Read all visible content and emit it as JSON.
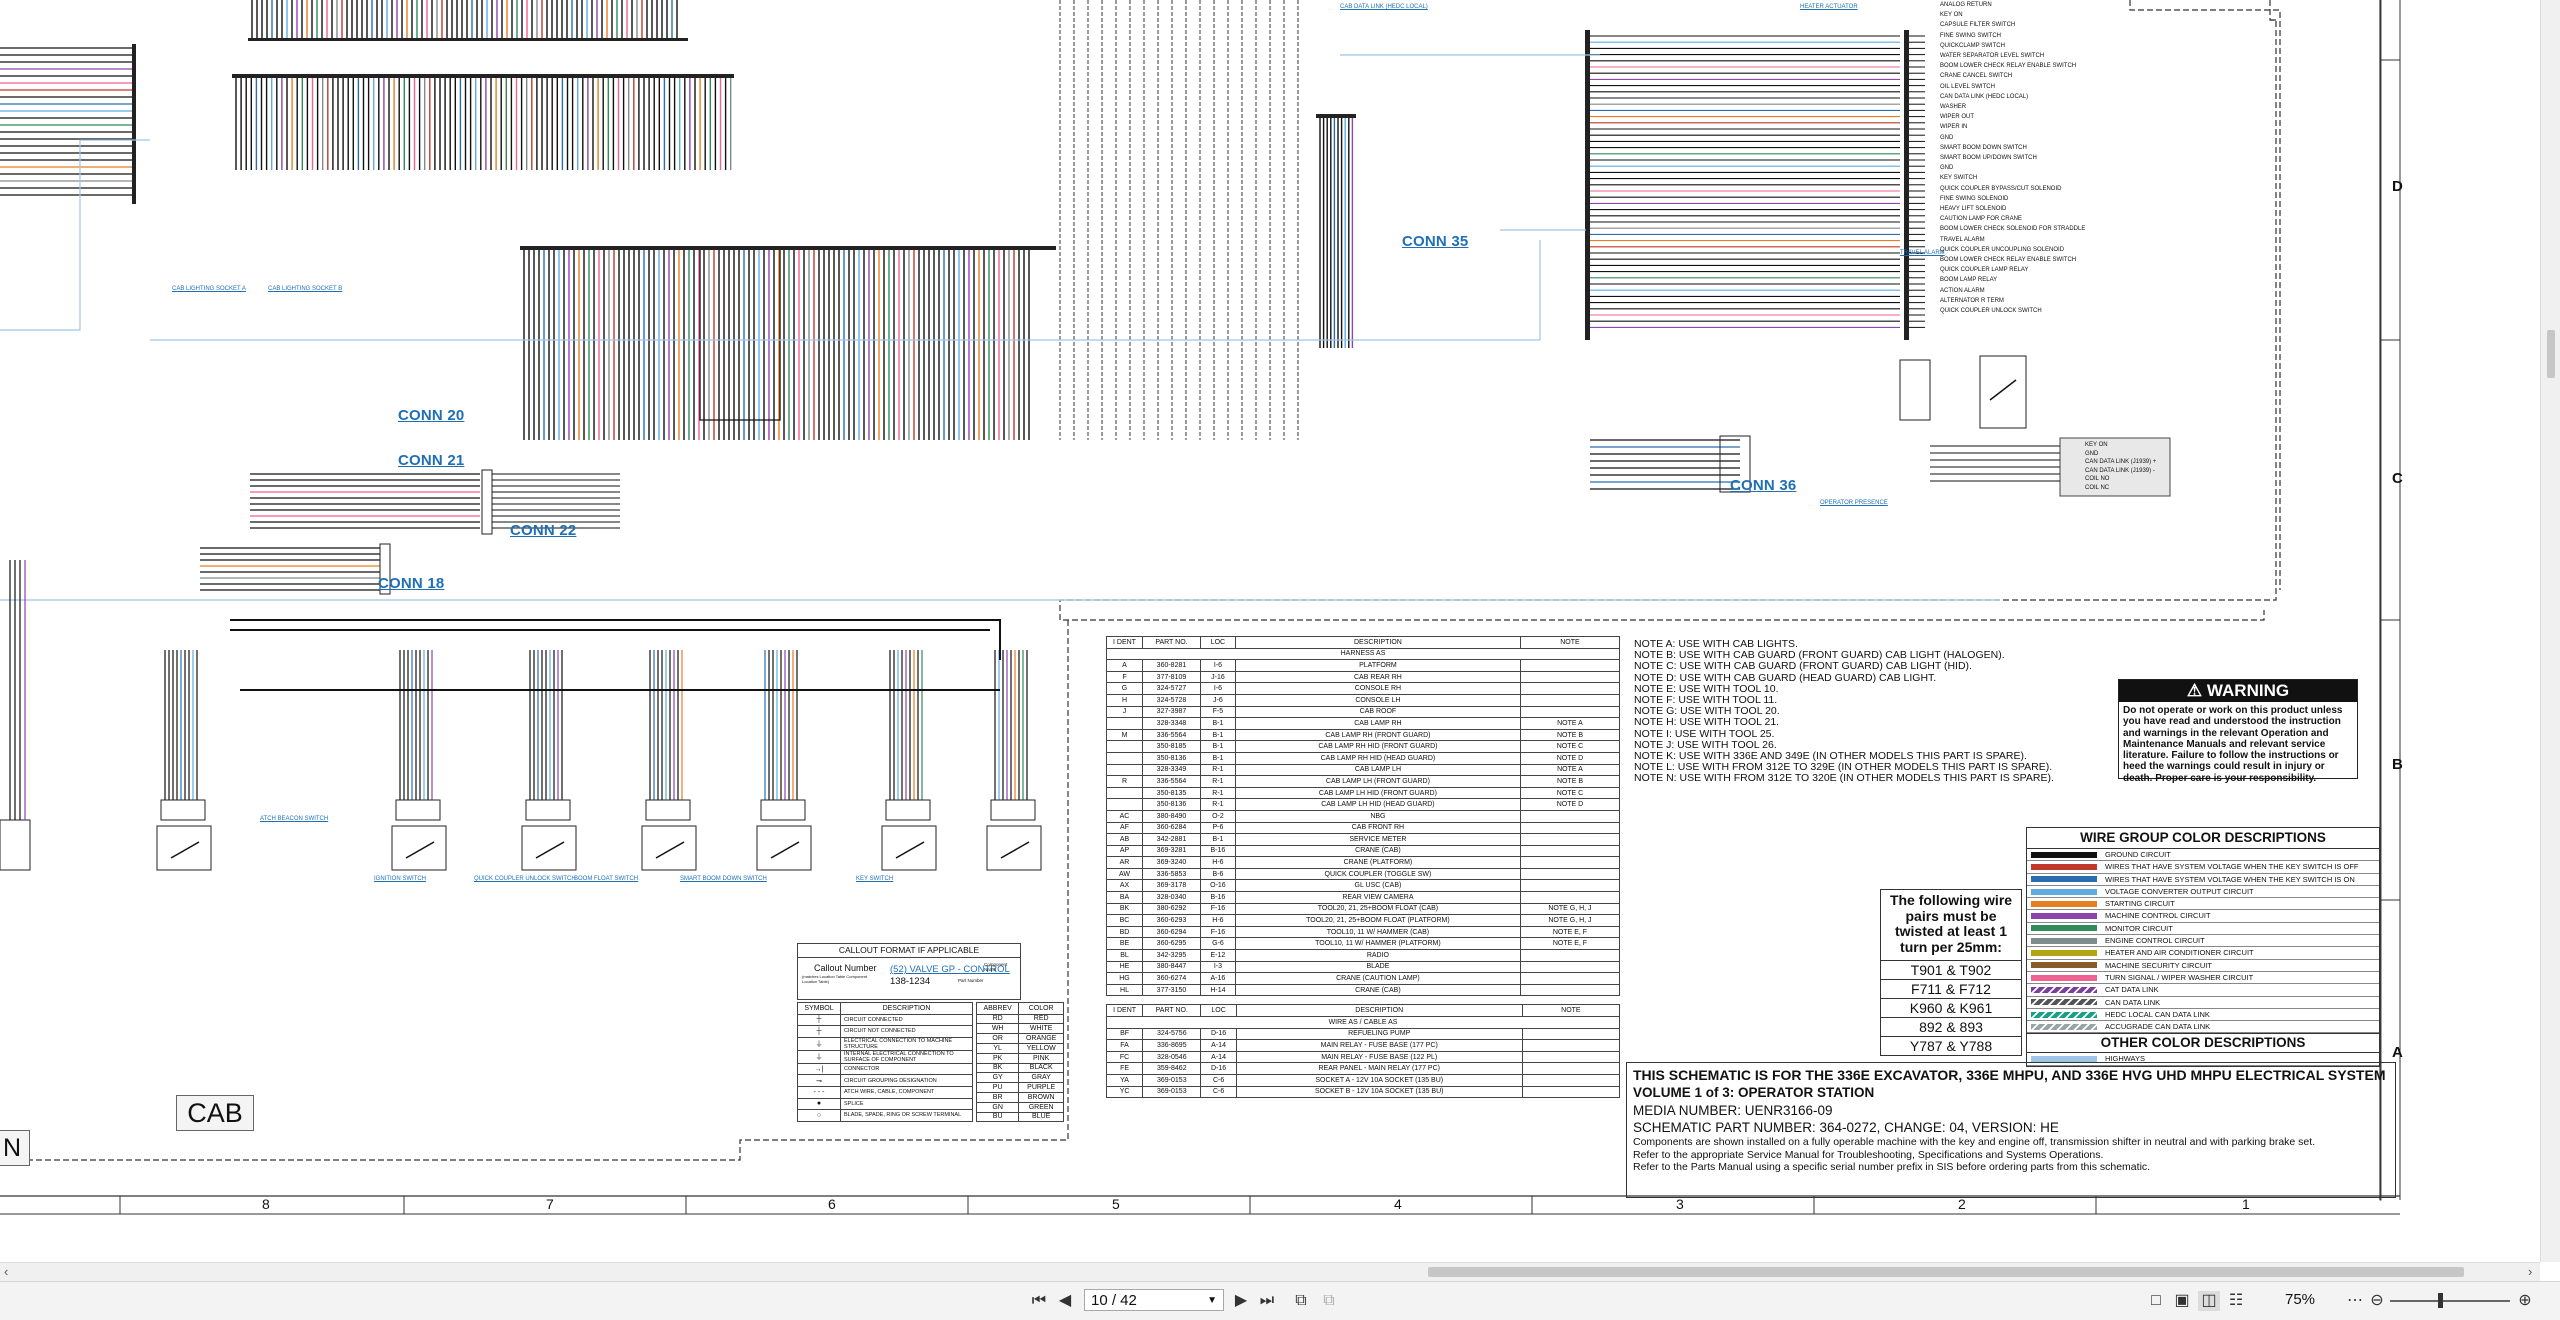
{
  "viewer": {
    "page_value": "10 / 42",
    "zoom": "75%",
    "icons": {
      "first": "first-page-icon",
      "prev": "prev-page-icon",
      "next": "next-page-icon",
      "last": "last-page-icon",
      "dropdown": "chevron-down-icon",
      "zoom_out": "zoom-out-icon",
      "zoom_in": "zoom-in-icon",
      "zoom_menu": "zoom-menu-icon"
    }
  },
  "connectors": {
    "conn35": "CONN 35",
    "conn20": "CONN 20",
    "conn21": "CONN 21",
    "conn22": "CONN 22",
    "conn18": "CONN 18",
    "conn36": "CONN 36"
  },
  "cab_label": "CAB",
  "n_label": "N",
  "zone_numbers": [
    "8",
    "7",
    "6",
    "5",
    "4",
    "3",
    "2",
    "1"
  ],
  "zone_letters": [
    "D",
    "C",
    "B",
    "A"
  ],
  "notes": [
    "NOTE A: USE WITH CAB LIGHTS.",
    "NOTE B: USE WITH CAB GUARD (FRONT GUARD) CAB LIGHT (HALOGEN).",
    "NOTE C: USE WITH CAB GUARD (FRONT GUARD) CAB LIGHT (HID).",
    "NOTE D: USE WITH CAB GUARD (HEAD GUARD) CAB LIGHT.",
    "NOTE E: USE WITH TOOL 10.",
    "NOTE F: USE WITH TOOL 11.",
    "NOTE G: USE WITH TOOL 20.",
    "NOTE H: USE WITH TOOL 21.",
    "NOTE I: USE WITH TOOL 25.",
    "NOTE J: USE WITH TOOL 26.",
    "NOTE K: USE WITH 336E AND 349E (IN OTHER MODELS THIS PART IS SPARE).",
    "NOTE L: USE WITH FROM 312E TO 329E (IN OTHER MODELS THIS PART IS SPARE).",
    "NOTE N: USE WITH FROM 312E TO 320E (IN OTHER MODELS THIS PART IS SPARE)."
  ],
  "warning": {
    "title": "WARNING",
    "body": "Do not operate or work on this product unless you have read and understood the instruction and warnings in the relevant Operation and Maintenance Manuals and relevant service literature. Failure to follow the instructions or heed the warnings could result in injury or death. Proper care is your responsibility."
  },
  "wire_groups": {
    "title": "WIRE GROUP COLOR DESCRIPTIONS",
    "items": [
      {
        "label": "GROUND CIRCUIT",
        "color": "#111111"
      },
      {
        "label": "WIRES THAT HAVE SYSTEM VOLTAGE WHEN THE KEY SWITCH IS OFF",
        "color": "#c0392b"
      },
      {
        "label": "WIRES THAT HAVE SYSTEM VOLTAGE WHEN THE KEY SWITCH IS ON",
        "color": "#2b6cb0"
      },
      {
        "label": "VOLTAGE CONVERTER OUTPUT CIRCUIT",
        "color": "#5dade2"
      },
      {
        "label": "STARTING CIRCUIT",
        "color": "#e67e22"
      },
      {
        "label": "MACHINE CONTROL CIRCUIT",
        "color": "#8e44ad"
      },
      {
        "label": "MONITOR CIRCUIT",
        "color": "#2e8b57"
      },
      {
        "label": "ENGINE CONTROL CIRCUIT",
        "color": "#7f8c8d"
      },
      {
        "label": "HEATER AND AIR CONDITIONER CIRCUIT",
        "color": "#b5a316"
      },
      {
        "label": "MACHINE SECURITY CIRCUIT",
        "color": "#8b5a2b"
      },
      {
        "label": "TURN SIGNAL / WIPER WASHER CIRCUIT",
        "color": "#f06292"
      },
      {
        "label": "CAT DATA LINK",
        "color": "#7b3f9e"
      },
      {
        "label": "CAN DATA LINK",
        "color": "#555555"
      },
      {
        "label": "HEDC LOCAL CAN DATA LINK",
        "color": "#16a085"
      },
      {
        "label": "ACCUGRADE CAN DATA LINK",
        "color": "#95a5a6"
      }
    ],
    "other_title": "OTHER COLOR DESCRIPTIONS",
    "other_items": [
      {
        "label": "HIGHWAYS",
        "color": "#9ec5e8"
      }
    ]
  },
  "twist": {
    "heading": "The following wire pairs must be twisted at least 1 turn per 25mm:",
    "pairs": [
      "T901 & T902",
      "F711 & F712",
      "K960 & K961",
      "892 & 893",
      "Y787 & Y788"
    ]
  },
  "title_block": {
    "line1": "THIS SCHEMATIC IS FOR THE 336E EXCAVATOR, 336E MHPU, AND 336E HVG UHD MHPU ELECTRICAL SYSTEM",
    "line2": "VOLUME 1 of 3: OPERATOR STATION",
    "line3": "MEDIA NUMBER: UENR3166-09",
    "line4": "SCHEMATIC PART NUMBER: 364-0272, CHANGE: 04, VERSION: HE",
    "line5": "Components are shown installed on a fully operable machine with the key and engine off, transmission shifter in neutral and with parking brake set.",
    "line6": "Refer to the appropriate Service Manual for Troubleshooting, Specifications and Systems Operations.",
    "line7": "Refer to the Parts Manual using a specific serial number prefix in SIS before ordering parts from this schematic."
  },
  "callout": {
    "title": "CALLOUT FORMAT IF APPLICABLE",
    "callout_number": "Callout Number",
    "callout_sub": "(matches Location Table Component Location Table)",
    "example": "(52) VALVE GP - CONTROL",
    "part": "138-1234",
    "part_note": "Part Number",
    "comp_name": "Component Name"
  },
  "symbols": {
    "headers": [
      "SYMBOL",
      "DESCRIPTION"
    ],
    "rows": [
      "CIRCUIT CONNECTED",
      "CIRCUIT NOT CONNECTED",
      "ELECTRICAL CONNECTION TO MACHINE STRUCTURE",
      "INTERNAL ELECTRICAL CONNECTION TO SURFACE OF COMPONENT",
      "CONNECTOR",
      "CIRCUIT GROUPING DESIGNATION",
      "ATCH WIRE, CABLE, COMPONENT",
      "SPLICE",
      "BLADE, SPADE, RING OR SCREW TERMINAL"
    ]
  },
  "colors_abbrev": {
    "headers": [
      "ABBREV",
      "COLOR"
    ],
    "rows": [
      [
        "RD",
        "RED"
      ],
      [
        "WH",
        "WHITE"
      ],
      [
        "OR",
        "ORANGE"
      ],
      [
        "YL",
        "YELLOW"
      ],
      [
        "PK",
        "PINK"
      ],
      [
        "BK",
        "BLACK"
      ],
      [
        "GY",
        "GRAY"
      ],
      [
        "PU",
        "PURPLE"
      ],
      [
        "BR",
        "BROWN"
      ],
      [
        "GN",
        "GREEN"
      ],
      [
        "BU",
        "BLUE"
      ]
    ]
  },
  "harness_table": {
    "headers": [
      "I DENT",
      "PART NO.",
      "LOC",
      "DESCRIPTION",
      "NOTE"
    ],
    "group": "HARNESS AS",
    "rows": [
      [
        "A",
        "360-8281",
        "I-6",
        "PLATFORM",
        ""
      ],
      [
        "F",
        "377-8109",
        "J-16",
        "CAB REAR RH",
        ""
      ],
      [
        "G",
        "324-5727",
        "I-6",
        "CONSOLE RH",
        ""
      ],
      [
        "H",
        "324-5728",
        "J-6",
        "CONSOLE LH",
        ""
      ],
      [
        "J",
        "327-3987",
        "F-5",
        "CAB ROOF",
        ""
      ],
      [
        "",
        "328-3348",
        "B-1",
        "CAB LAMP RH",
        "NOTE A"
      ],
      [
        "M",
        "336-5564",
        "B-1",
        "CAB LAMP RH (FRONT GUARD)",
        "NOTE B"
      ],
      [
        "",
        "350-8185",
        "B-1",
        "CAB LAMP RH HID (FRONT GUARD)",
        "NOTE C"
      ],
      [
        "",
        "350-8136",
        "B-1",
        "CAB LAMP RH HID (HEAD GUARD)",
        "NOTE D"
      ],
      [
        "",
        "328-3349",
        "R-1",
        "CAB LAMP LH",
        "NOTE A"
      ],
      [
        "R",
        "336-5564",
        "R-1",
        "CAB LAMP LH (FRONT GUARD)",
        "NOTE B"
      ],
      [
        "",
        "350-8135",
        "R-1",
        "CAB LAMP LH HID (FRONT GUARD)",
        "NOTE C"
      ],
      [
        "",
        "350-8136",
        "R-1",
        "CAB LAMP LH HID (HEAD GUARD)",
        "NOTE D"
      ],
      [
        "AC",
        "380-8490",
        "O-2",
        "NBG",
        ""
      ],
      [
        "AF",
        "360-6284",
        "P-6",
        "CAB FRONT RH",
        ""
      ],
      [
        "AB",
        "342-2881",
        "B-1",
        "SERVICE METER",
        ""
      ],
      [
        "AP",
        "369-3281",
        "B-16",
        "CRANE (CAB)",
        ""
      ],
      [
        "AR",
        "369-3240",
        "H-6",
        "CRANE (PLATFORM)",
        ""
      ],
      [
        "AW",
        "336-5853",
        "B-6",
        "QUICK COUPLER (TOGGLE SW)",
        ""
      ],
      [
        "AX",
        "369-3178",
        "O-16",
        "GL USC (CAB)",
        ""
      ],
      [
        "BA",
        "328-0340",
        "B-16",
        "REAR VIEW CAMERA",
        ""
      ],
      [
        "BK",
        "380-6292",
        "F-16",
        "TOOL20, 21, 25+BOOM FLOAT (CAB)",
        "NOTE G, H, J"
      ],
      [
        "BC",
        "360-6293",
        "H-6",
        "TOOL20, 21, 25+BOOM FLOAT (PLATFORM)",
        "NOTE G, H, J"
      ],
      [
        "BD",
        "360-6294",
        "F-16",
        "TOOL10, 11 W/ HAMMER (CAB)",
        "NOTE E, F"
      ],
      [
        "BE",
        "360-6295",
        "G-6",
        "TOOL10, 11 W/ HAMMER (PLATFORM)",
        "NOTE E, F"
      ],
      [
        "BL",
        "342-3295",
        "E-12",
        "RADIO",
        ""
      ],
      [
        "HE",
        "380-8447",
        "I-3",
        "BLADE",
        ""
      ],
      [
        "HG",
        "360-6274",
        "A-16",
        "CRANE (CAUTION LAMP)",
        ""
      ],
      [
        "HL",
        "377-3150",
        "H-14",
        "CRANE (CAB)",
        ""
      ]
    ],
    "group2": "WIRE AS / CABLE AS",
    "rows2": [
      [
        "BF",
        "324-5756",
        "D-16",
        "REFUELING PUMP",
        ""
      ],
      [
        "FA",
        "336-8695",
        "A-14",
        "MAIN RELAY - FUSE BASE (177 PC)",
        ""
      ],
      [
        "FC",
        "328-0546",
        "A-14",
        "MAIN RELAY - FUSE BASE (122 PL)",
        ""
      ],
      [
        "FE",
        "359-8462",
        "D-16",
        "REAR PANEL - MAIN RELAY (177 PC)",
        ""
      ],
      [
        "YA",
        "369-0153",
        "C-6",
        "SOCKET A - 12V 10A SOCKET (135 BU)",
        ""
      ],
      [
        "YC",
        "369-0153",
        "C-6",
        "SOCKET B - 12V 10A SOCKET (135 BU)",
        ""
      ]
    ]
  },
  "component_labels": [
    "CAB LIGHTING SOCKET A",
    "CAB LIGHTING SOCKET B",
    "ATCH BEACON SWITCH",
    "IGNITION SWITCH",
    "QUICK COUPLER UNLOCK SWITCH",
    "BOOM FLOAT SWITCH",
    "SMART BOOM DOWN SWITCH",
    "KEY SWITCH",
    "CAB DATA LINK (HEDC LOCAL)",
    "HEATER ACTUATOR",
    "TRAVEL ALARM",
    "OPERATOR PRESENCE"
  ],
  "right_bus_labels": [
    "ANALOG RETURN",
    "KEY ON",
    "CAPSULE FILTER SWITCH",
    "FINE SWING SWITCH",
    "QUICKCLAMP SWITCH",
    "WATER SEPARATOR LEVEL SWITCH",
    "BOOM LOWER CHECK RELAY ENABLE SWITCH",
    "CRANE CANCEL SWITCH",
    "OIL LEVEL SWITCH",
    "CAN DATA LINK (HEDC LOCAL)",
    "WASHER",
    "WIPER OUT",
    "WIPER IN",
    "GND",
    "SMART BOOM DOWN SWITCH",
    "SMART BOOM UP/DOWN SWITCH",
    "GND",
    "KEY SWITCH",
    "QUICK COUPLER BYPASS/CUT SOLENOID",
    "FINE SWING SOLENOID",
    "HEAVY LIFT SOLENOID",
    "CAUTION LAMP FOR CRANE",
    "BOOM LOWER CHECK SOLENOID FOR STRADDLE",
    "TRAVEL ALARM",
    "QUICK COUPLER UNCOUPLING SOLENOID",
    "BOOM LOWER CHECK RELAY ENABLE SWITCH",
    "QUICK COUPLER LAMP RELAY",
    "BOOM LAMP RELAY",
    "ACTION ALARM",
    "ALTERNATOR R TERM",
    "QUICK COUPLER UNLOCK SWITCH"
  ],
  "ecu_labels": [
    "KEY ON",
    "GND",
    "CAN DATA LINK (J1939) +",
    "CAN DATA LINK (J1939) -",
    "COIL NO",
    "COIL NC"
  ]
}
